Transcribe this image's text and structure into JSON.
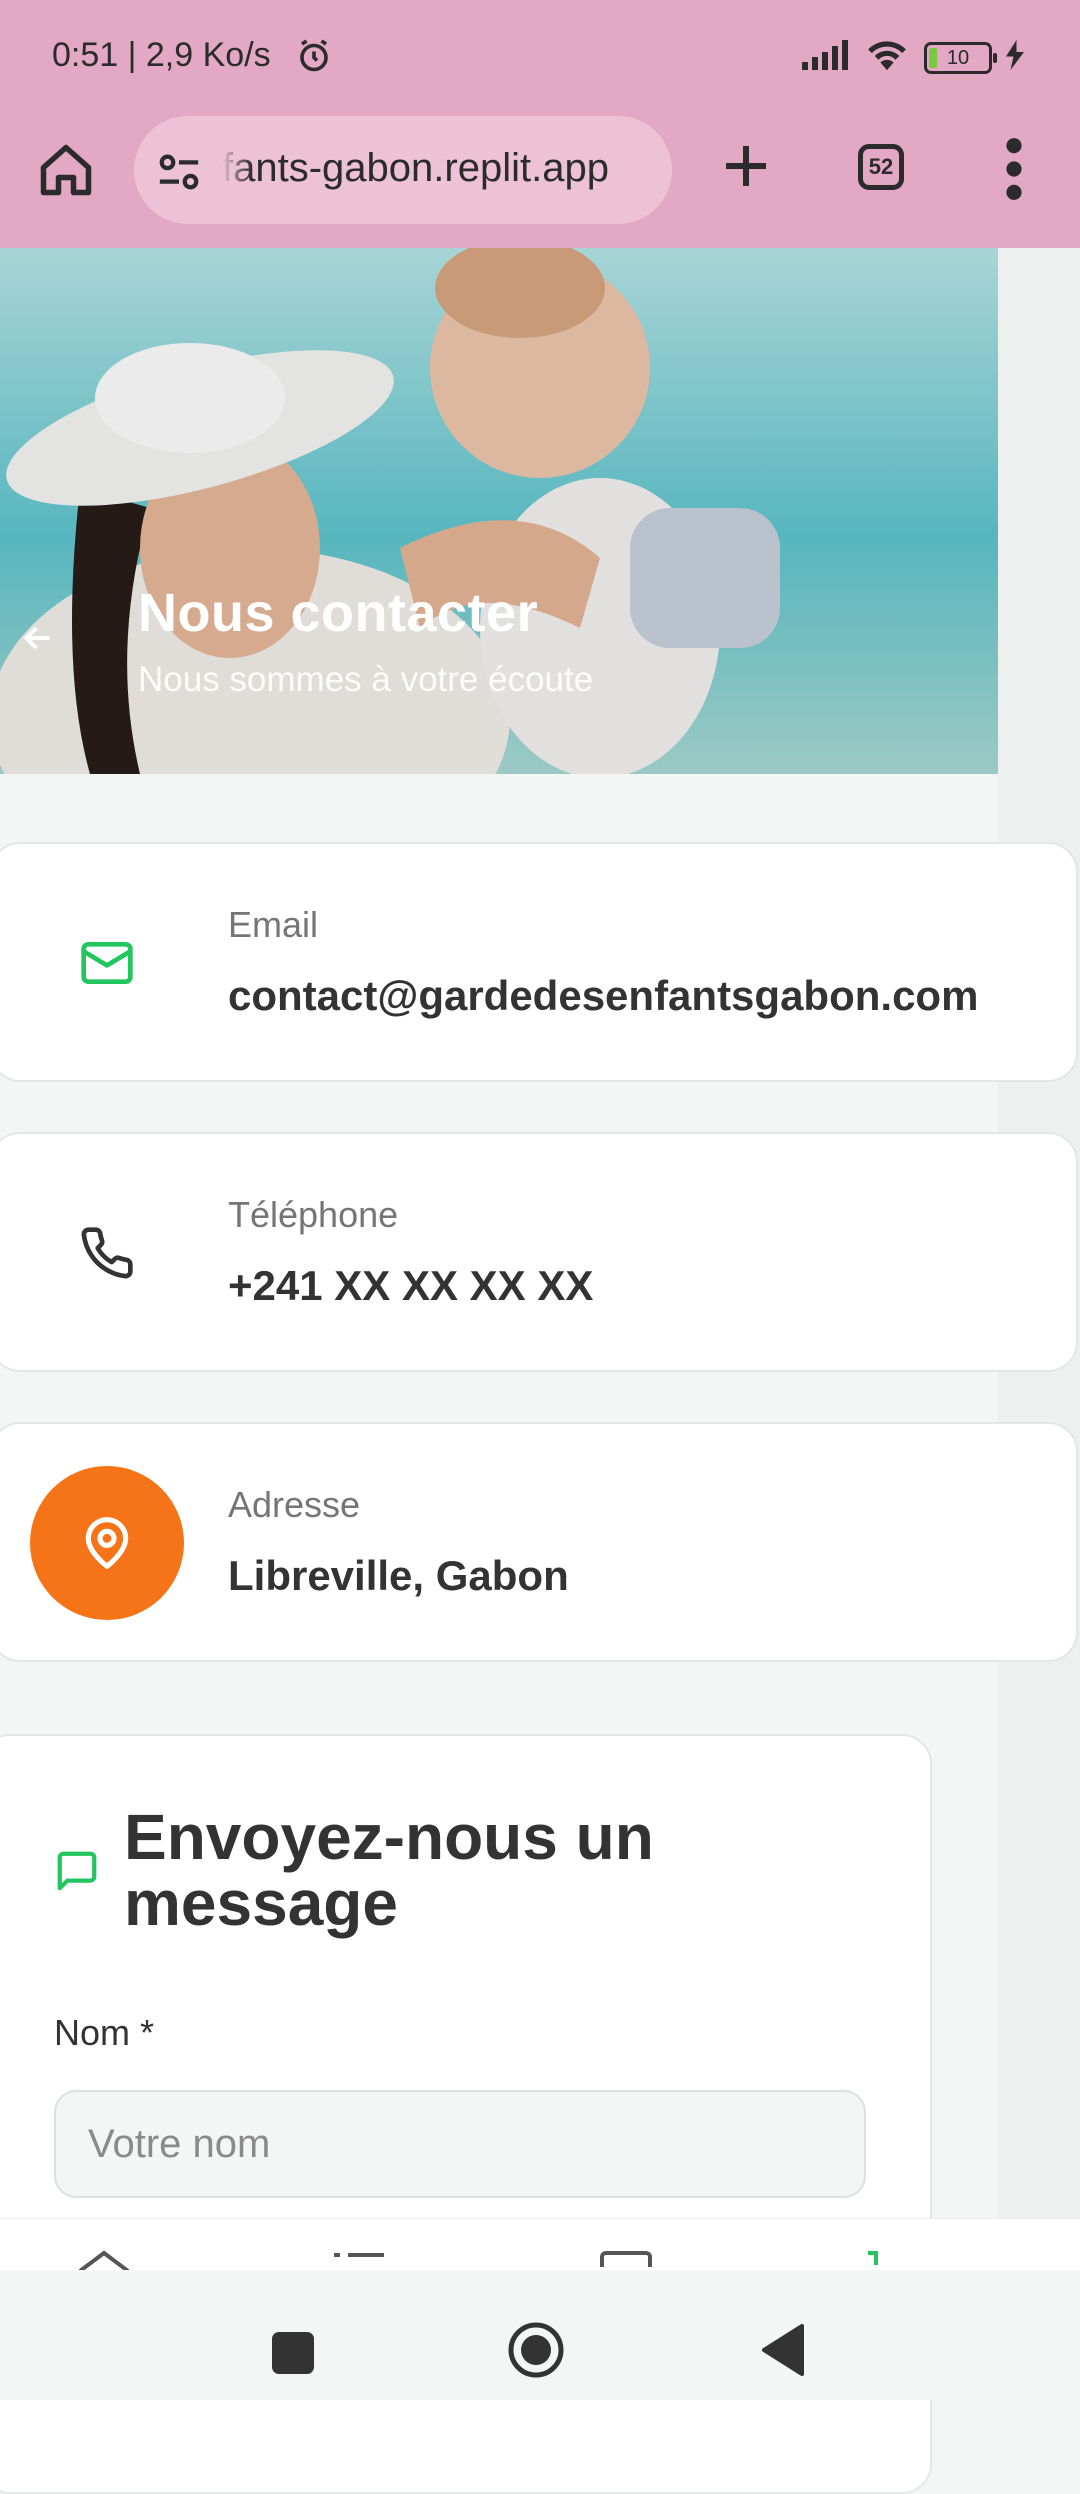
{
  "status_bar": {
    "time": "0:51 | 2,9 Ko/s",
    "battery": "10",
    "icons": [
      "alarm-icon",
      "signal-icon",
      "wifi-icon",
      "battery-icon",
      "charging-icon"
    ]
  },
  "browser": {
    "url": "fants-gabon.replit.app",
    "tab_count": "52",
    "icons": [
      "home-icon",
      "site-settings-icon",
      "plus-icon",
      "tabs-icon",
      "more-vert-icon"
    ]
  },
  "hero": {
    "title": "Nous contacter",
    "subtitle": "Nous sommes à votre écoute"
  },
  "contacts": [
    {
      "label": "Email",
      "value": "contact@gardedesenfantsgabon.com",
      "icon": "mail-icon",
      "icon_color": "#22c55e"
    },
    {
      "label": "Téléphone",
      "value": "+241 XX XX XX XX",
      "icon": "phone-icon",
      "icon_color": "#333333"
    },
    {
      "label": "Adresse",
      "value": "Libreville, Gabon",
      "icon": "map-pin-icon",
      "icon_bg": "#f67418"
    }
  ],
  "form": {
    "title": "Envoyez-nous un message",
    "icon": "message-square-icon",
    "name_label": "Nom *",
    "name_placeholder": "Votre nom"
  },
  "colors": {
    "chrome": "#e3a8c3",
    "accent_green": "#22c55e",
    "accent_orange": "#f67418"
  }
}
